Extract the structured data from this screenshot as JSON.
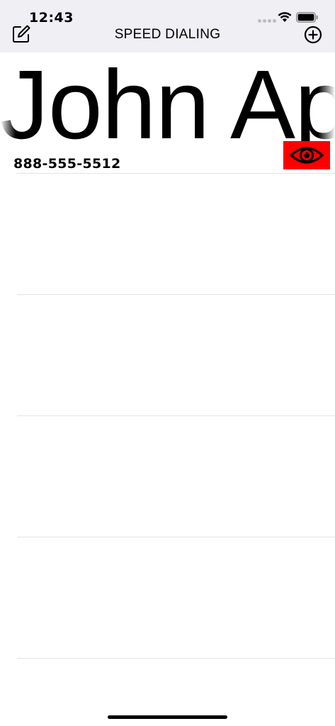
{
  "status_bar": {
    "time": "12:43",
    "icons": [
      "signal-dots-icon",
      "wifi-icon",
      "battery-icon"
    ]
  },
  "nav": {
    "title": "SPEED DIALING",
    "left_icon": "compose-icon",
    "right_icon": "add-circle-icon"
  },
  "contacts": [
    {
      "name": "John Ap",
      "phone": "888-555-5512",
      "action_icon": "eye-icon",
      "action_color": "#ff0000"
    }
  ],
  "empty_rows": 4,
  "colors": {
    "bar_background": "#efeff4",
    "separator": "#e3e3e6",
    "accent": "#ff0000"
  }
}
